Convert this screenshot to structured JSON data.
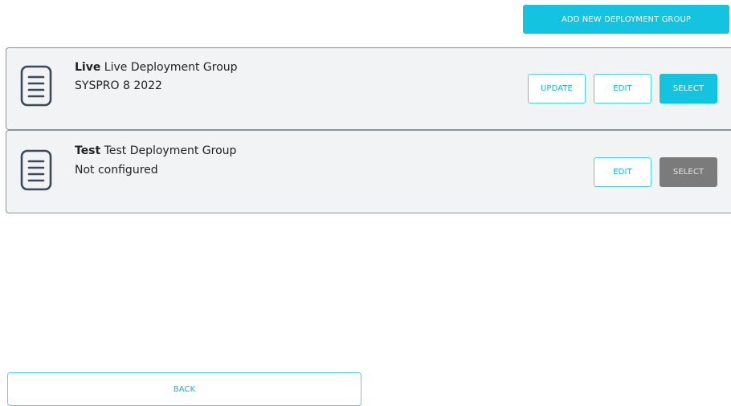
{
  "toolbar": {
    "add_label": "ADD NEW DEPLOYMENT GROUP"
  },
  "groups": [
    {
      "name": "Live",
      "description": "Live Deployment Group",
      "status": "SYSPRO 8 2022",
      "icon": "document-icon",
      "buttons": {
        "update": "UPDATE",
        "edit": "EDIT",
        "select": "SELECT"
      },
      "select_enabled": true
    },
    {
      "name": "Test",
      "description": "Test Deployment Group",
      "status": "Not configured",
      "icon": "document-icon",
      "buttons": {
        "edit": "EDIT",
        "select": "SELECT"
      },
      "select_enabled": false
    }
  ],
  "footer": {
    "back_label": "BACK"
  },
  "colors": {
    "accent": "#14c3e0",
    "disabled": "#7b7b7b",
    "card_bg": "#f1f3f4",
    "card_border": "#8c949a",
    "icon_stroke": "#3a4a5a"
  }
}
